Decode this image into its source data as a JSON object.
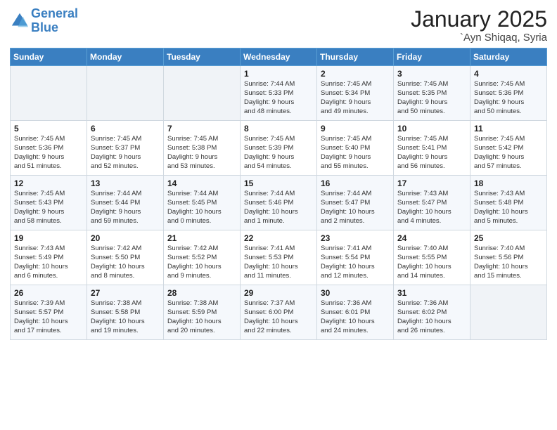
{
  "header": {
    "logo_line1": "General",
    "logo_line2": "Blue",
    "title": "January 2025",
    "subtitle": "`Ayn Shiqaq, Syria"
  },
  "days_of_week": [
    "Sunday",
    "Monday",
    "Tuesday",
    "Wednesday",
    "Thursday",
    "Friday",
    "Saturday"
  ],
  "weeks": [
    [
      {
        "day": "",
        "data": ""
      },
      {
        "day": "",
        "data": ""
      },
      {
        "day": "",
        "data": ""
      },
      {
        "day": "1",
        "data": "Sunrise: 7:44 AM\nSunset: 5:33 PM\nDaylight: 9 hours\nand 48 minutes."
      },
      {
        "day": "2",
        "data": "Sunrise: 7:45 AM\nSunset: 5:34 PM\nDaylight: 9 hours\nand 49 minutes."
      },
      {
        "day": "3",
        "data": "Sunrise: 7:45 AM\nSunset: 5:35 PM\nDaylight: 9 hours\nand 50 minutes."
      },
      {
        "day": "4",
        "data": "Sunrise: 7:45 AM\nSunset: 5:36 PM\nDaylight: 9 hours\nand 50 minutes."
      }
    ],
    [
      {
        "day": "5",
        "data": "Sunrise: 7:45 AM\nSunset: 5:36 PM\nDaylight: 9 hours\nand 51 minutes."
      },
      {
        "day": "6",
        "data": "Sunrise: 7:45 AM\nSunset: 5:37 PM\nDaylight: 9 hours\nand 52 minutes."
      },
      {
        "day": "7",
        "data": "Sunrise: 7:45 AM\nSunset: 5:38 PM\nDaylight: 9 hours\nand 53 minutes."
      },
      {
        "day": "8",
        "data": "Sunrise: 7:45 AM\nSunset: 5:39 PM\nDaylight: 9 hours\nand 54 minutes."
      },
      {
        "day": "9",
        "data": "Sunrise: 7:45 AM\nSunset: 5:40 PM\nDaylight: 9 hours\nand 55 minutes."
      },
      {
        "day": "10",
        "data": "Sunrise: 7:45 AM\nSunset: 5:41 PM\nDaylight: 9 hours\nand 56 minutes."
      },
      {
        "day": "11",
        "data": "Sunrise: 7:45 AM\nSunset: 5:42 PM\nDaylight: 9 hours\nand 57 minutes."
      }
    ],
    [
      {
        "day": "12",
        "data": "Sunrise: 7:45 AM\nSunset: 5:43 PM\nDaylight: 9 hours\nand 58 minutes."
      },
      {
        "day": "13",
        "data": "Sunrise: 7:44 AM\nSunset: 5:44 PM\nDaylight: 9 hours\nand 59 minutes."
      },
      {
        "day": "14",
        "data": "Sunrise: 7:44 AM\nSunset: 5:45 PM\nDaylight: 10 hours\nand 0 minutes."
      },
      {
        "day": "15",
        "data": "Sunrise: 7:44 AM\nSunset: 5:46 PM\nDaylight: 10 hours\nand 1 minute."
      },
      {
        "day": "16",
        "data": "Sunrise: 7:44 AM\nSunset: 5:47 PM\nDaylight: 10 hours\nand 2 minutes."
      },
      {
        "day": "17",
        "data": "Sunrise: 7:43 AM\nSunset: 5:47 PM\nDaylight: 10 hours\nand 4 minutes."
      },
      {
        "day": "18",
        "data": "Sunrise: 7:43 AM\nSunset: 5:48 PM\nDaylight: 10 hours\nand 5 minutes."
      }
    ],
    [
      {
        "day": "19",
        "data": "Sunrise: 7:43 AM\nSunset: 5:49 PM\nDaylight: 10 hours\nand 6 minutes."
      },
      {
        "day": "20",
        "data": "Sunrise: 7:42 AM\nSunset: 5:50 PM\nDaylight: 10 hours\nand 8 minutes."
      },
      {
        "day": "21",
        "data": "Sunrise: 7:42 AM\nSunset: 5:52 PM\nDaylight: 10 hours\nand 9 minutes."
      },
      {
        "day": "22",
        "data": "Sunrise: 7:41 AM\nSunset: 5:53 PM\nDaylight: 10 hours\nand 11 minutes."
      },
      {
        "day": "23",
        "data": "Sunrise: 7:41 AM\nSunset: 5:54 PM\nDaylight: 10 hours\nand 12 minutes."
      },
      {
        "day": "24",
        "data": "Sunrise: 7:40 AM\nSunset: 5:55 PM\nDaylight: 10 hours\nand 14 minutes."
      },
      {
        "day": "25",
        "data": "Sunrise: 7:40 AM\nSunset: 5:56 PM\nDaylight: 10 hours\nand 15 minutes."
      }
    ],
    [
      {
        "day": "26",
        "data": "Sunrise: 7:39 AM\nSunset: 5:57 PM\nDaylight: 10 hours\nand 17 minutes."
      },
      {
        "day": "27",
        "data": "Sunrise: 7:38 AM\nSunset: 5:58 PM\nDaylight: 10 hours\nand 19 minutes."
      },
      {
        "day": "28",
        "data": "Sunrise: 7:38 AM\nSunset: 5:59 PM\nDaylight: 10 hours\nand 20 minutes."
      },
      {
        "day": "29",
        "data": "Sunrise: 7:37 AM\nSunset: 6:00 PM\nDaylight: 10 hours\nand 22 minutes."
      },
      {
        "day": "30",
        "data": "Sunrise: 7:36 AM\nSunset: 6:01 PM\nDaylight: 10 hours\nand 24 minutes."
      },
      {
        "day": "31",
        "data": "Sunrise: 7:36 AM\nSunset: 6:02 PM\nDaylight: 10 hours\nand 26 minutes."
      },
      {
        "day": "",
        "data": ""
      }
    ]
  ]
}
